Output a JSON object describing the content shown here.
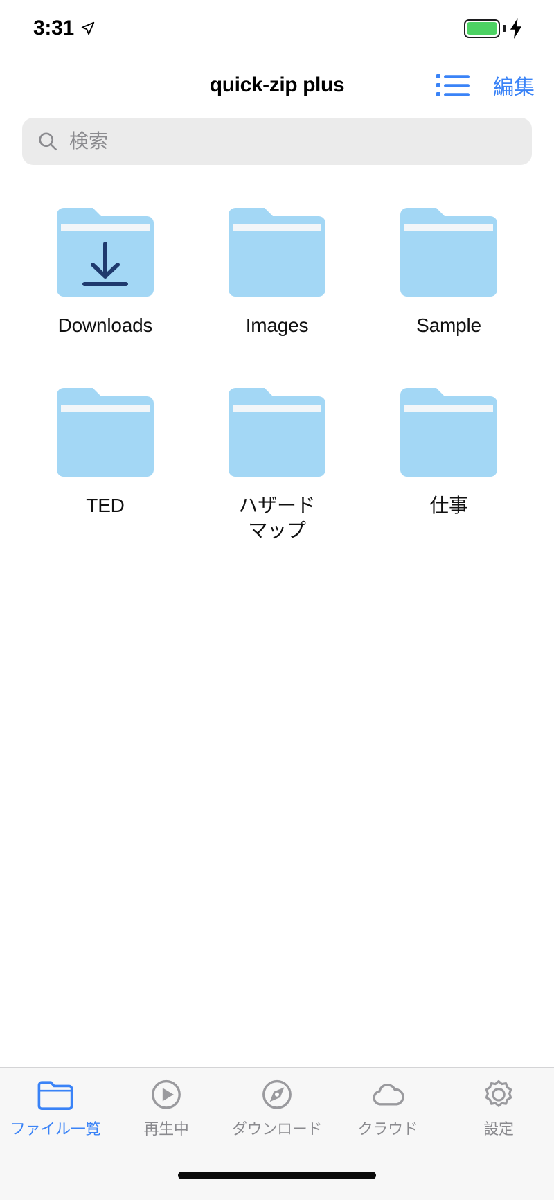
{
  "status_bar": {
    "time": "3:31",
    "location_icon": "location-arrow-icon",
    "battery_icon": "battery-icon",
    "charging_icon": "lightning-bolt-icon",
    "battery_color": "#4cd263"
  },
  "nav_bar": {
    "title": "quick-zip plus",
    "list_view_icon": "list-view-icon",
    "edit_label": "編集",
    "accent_color": "#3a83f7"
  },
  "search": {
    "icon": "search-icon",
    "placeholder": "検索",
    "value": ""
  },
  "folders": [
    {
      "name": "Downloads",
      "icon": "folder-download-icon",
      "badge": "download-arrow"
    },
    {
      "name": "Images",
      "icon": "folder-icon",
      "badge": ""
    },
    {
      "name": "Sample",
      "icon": "folder-icon",
      "badge": ""
    },
    {
      "name": "TED",
      "icon": "folder-icon",
      "badge": ""
    },
    {
      "name": "ハザード\nマップ",
      "icon": "folder-icon",
      "badge": ""
    },
    {
      "name": "仕事",
      "icon": "folder-icon",
      "badge": ""
    }
  ],
  "folder_colors": {
    "body": "#a3d7f5",
    "stripe": "#f2f6f9",
    "arrow": "#1f3a6e"
  },
  "tab_bar": [
    {
      "label": "ファイル一覧",
      "icon": "folder-outline-icon",
      "active": true
    },
    {
      "label": "再生中",
      "icon": "play-circle-icon",
      "active": false
    },
    {
      "label": "ダウンロード",
      "icon": "compass-icon",
      "active": false
    },
    {
      "label": "クラウド",
      "icon": "cloud-icon",
      "active": false
    },
    {
      "label": "設定",
      "icon": "gear-icon",
      "active": false
    }
  ],
  "tab_colors": {
    "active": "#3a83f7",
    "inactive": "#8a8a8e"
  }
}
